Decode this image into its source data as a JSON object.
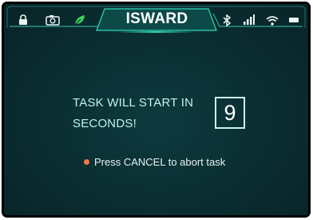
{
  "status_bar": {
    "title": "ISWARD",
    "left_icons": [
      "lock-icon",
      "camera-icon",
      "leaf-icon"
    ],
    "right_icons": [
      "bluetooth-icon",
      "signal-icon",
      "wifi-icon",
      "battery-icon"
    ]
  },
  "countdown": {
    "message_line1": "TASK WILL START IN",
    "message_line2": "SECONDS!",
    "value": "9"
  },
  "hint": {
    "text": "Press CANCEL to abort task",
    "dot_color": "#f07a4c"
  },
  "colors": {
    "accent": "#2fd6b8",
    "leaf": "#3fd35a",
    "background": "#0a2d31"
  }
}
